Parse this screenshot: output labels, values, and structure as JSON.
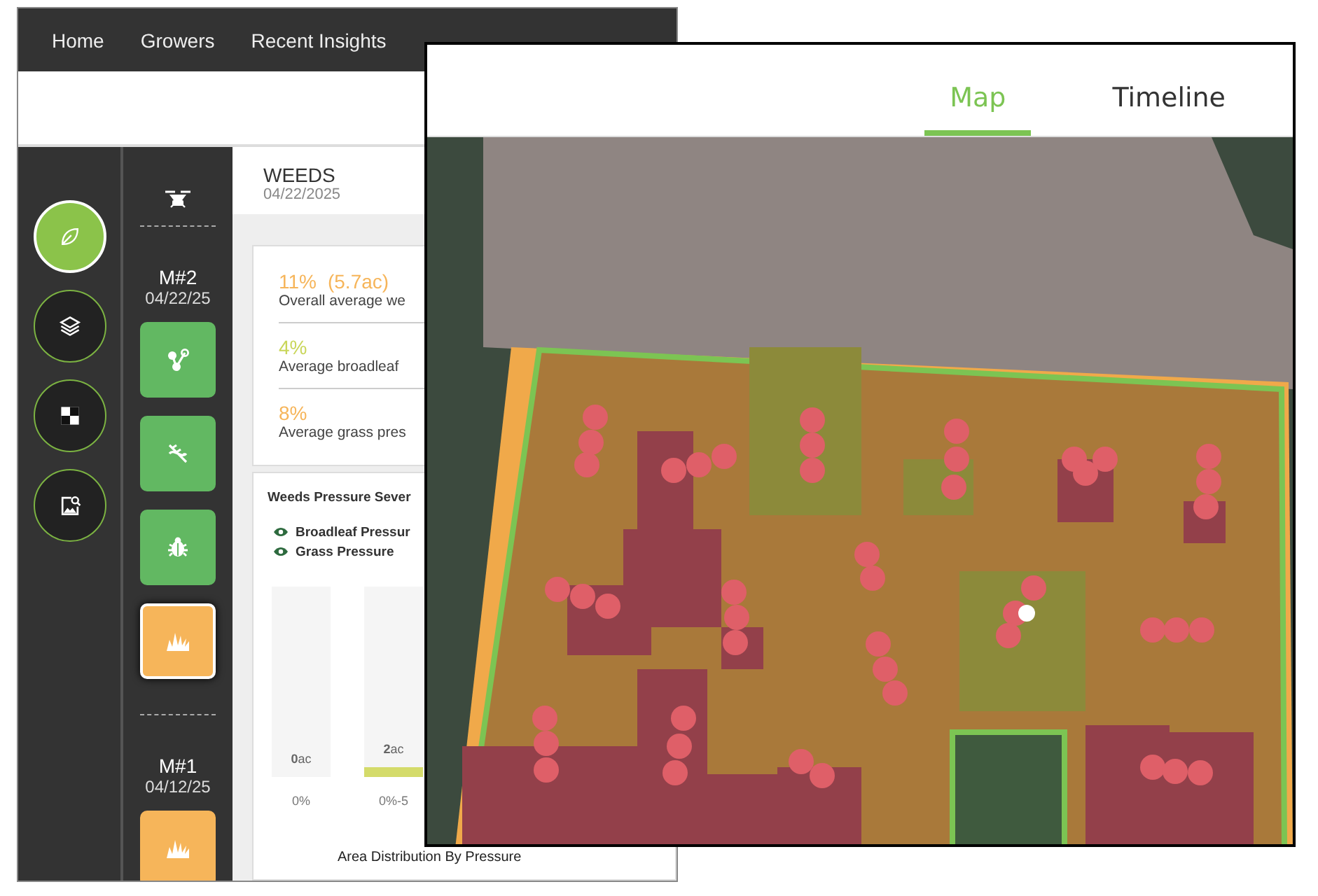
{
  "nav": {
    "links": [
      "Home",
      "Growers",
      "Recent Insights"
    ]
  },
  "rail": [
    {
      "kind": "leaf",
      "selected": true
    },
    {
      "kind": "layers",
      "selected": false
    },
    {
      "kind": "checker",
      "selected": false
    },
    {
      "kind": "image-search",
      "selected": false
    }
  ],
  "scans": [
    {
      "name": "M#2",
      "date": "04/22/25",
      "tools": [
        {
          "kind": "network",
          "color": "#62b862",
          "selected": false
        },
        {
          "kind": "dna",
          "color": "#62b862",
          "selected": false
        },
        {
          "kind": "bug",
          "color": "#62b862",
          "selected": false
        },
        {
          "kind": "grass",
          "color": "#f6b55a",
          "selected": true
        }
      ]
    },
    {
      "name": "M#1",
      "date": "04/12/25",
      "tools": [
        {
          "kind": "grass",
          "color": "#f6b55a",
          "selected": false
        }
      ]
    }
  ],
  "report": {
    "title": "WEEDS",
    "date": "04/22/2025"
  },
  "stats": [
    {
      "value": "11%",
      "extra": "(5.7ac)",
      "label": "Overall average we",
      "color": "#f6b55a"
    },
    {
      "value": "4%",
      "label": "Average broadleaf",
      "color": "#c9d65a"
    },
    {
      "value": "8%",
      "label": "Average grass pres",
      "color": "#f6b55a"
    }
  ],
  "pressure_card": {
    "title": "Weeds Pressure Sever",
    "legend": [
      {
        "label": "Broadleaf Pressur",
        "visible": true
      },
      {
        "label": "Grass Pressure",
        "visible": true
      }
    ],
    "bars": [
      {
        "amount": "**0**ac",
        "range": "0%",
        "level": 0
      },
      {
        "amount": "**2**ac",
        "range": "0%-5",
        "level": 0.05
      }
    ],
    "footer": "Area Distribution By Pressure"
  },
  "map_window": {
    "tabs": [
      {
        "label": "Map",
        "selected": true
      },
      {
        "label": "Timeline",
        "selected": false
      }
    ]
  }
}
